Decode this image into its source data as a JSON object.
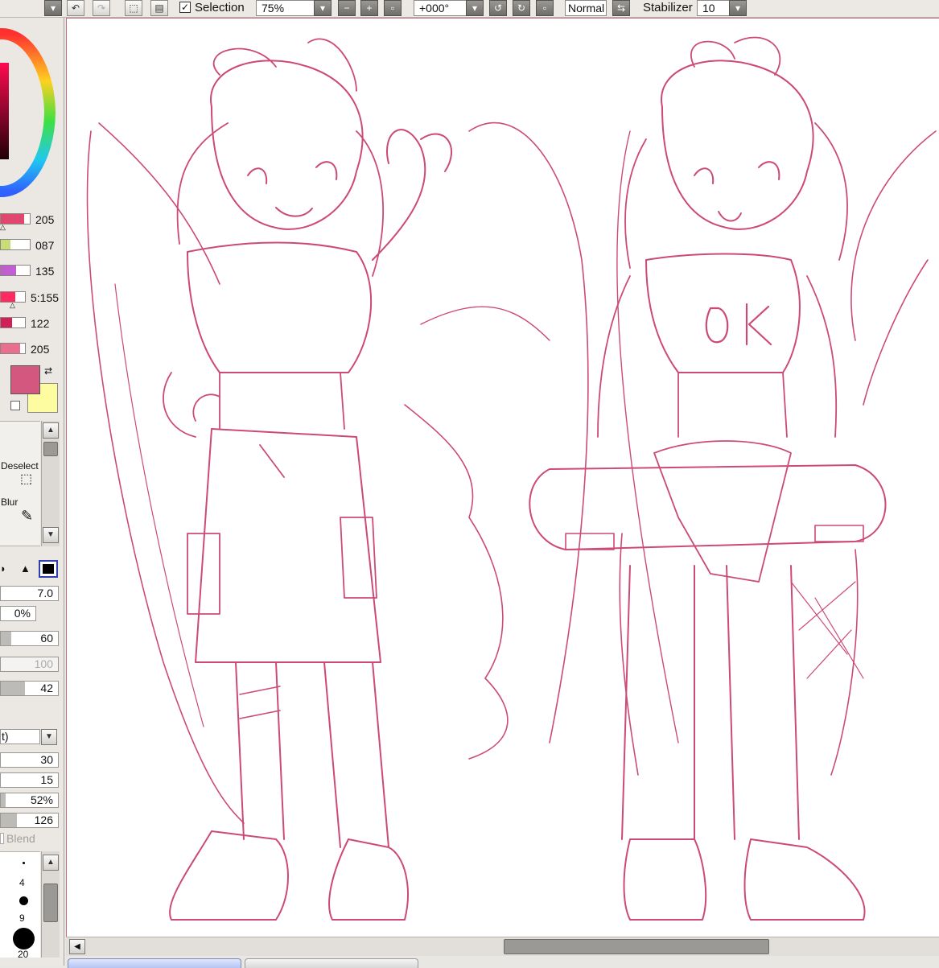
{
  "toolbar": {
    "selection_checked": true,
    "selection_label": "Selection",
    "zoom": "75%",
    "rotation": "+000°",
    "blend_mode": "Normal",
    "stabilizer_label": "Stabilizer",
    "stabilizer_value": "10"
  },
  "color_panel": {
    "sliders": [
      {
        "value": "205",
        "color": "#e0466e",
        "level": 0.8
      },
      {
        "value": "087",
        "color": "#c8dc78",
        "level": 0.34
      },
      {
        "value": "135",
        "color": "#c060d0",
        "level": 0.53
      },
      {
        "value": "5:155",
        "color": "#ff2a60",
        "level": 0.61
      },
      {
        "value": "122",
        "color": "#d02058",
        "level": 0.48
      },
      {
        "value": "205",
        "color": "#e8708e",
        "level": 0.8
      }
    ],
    "primary_color": "#d4577f",
    "secondary_color": "#fefca0"
  },
  "tools": {
    "deselect_label": "Deselect",
    "blur_label": "Blur"
  },
  "brush": {
    "size": "7.0",
    "min_size": "0%",
    "density": "60",
    "density_level": 0.6,
    "disabled_value": "100",
    "blending": "42",
    "blending_level": 0.42,
    "mode_label": "t)",
    "v1": "30",
    "v2": "15",
    "v3": "52%",
    "v3_level": 0.52,
    "v4": "126",
    "v4_level": 0.5,
    "blend_label": "Blend",
    "dot_sizes": [
      "4",
      "9",
      "20"
    ]
  },
  "colors": {
    "stroke": "#cc4a78"
  }
}
